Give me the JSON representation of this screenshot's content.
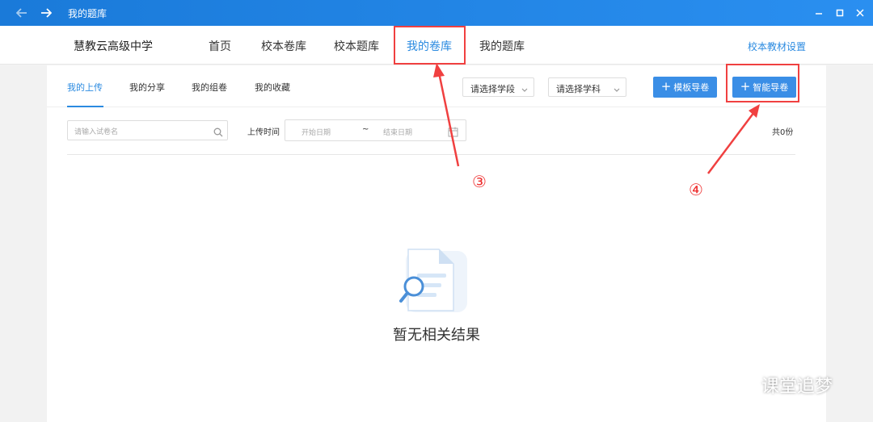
{
  "window": {
    "title": "我的题库"
  },
  "header": {
    "school_name": "慧教云高级中学",
    "nav": [
      "首页",
      "校本卷库",
      "校本题库",
      "我的卷库",
      "我的题库"
    ],
    "active_nav": "我的卷库",
    "textbook_settings": "校本教材设置"
  },
  "subtabs": [
    "我的上传",
    "我的分享",
    "我的组卷",
    "我的收藏"
  ],
  "active_subtab": "我的上传",
  "filters": {
    "stage_select": "请选择学段",
    "subject_select": "请选择学科",
    "template_button": "模板导卷",
    "smart_button": "智能导卷",
    "search_placeholder": "请输入试卷名",
    "upload_time_label": "上传时间",
    "start_date_placeholder": "开始日期",
    "range_separator": "~",
    "end_date_placeholder": "结束日期",
    "total": "共0份"
  },
  "empty_state": {
    "text": "暂无相关结果"
  },
  "annotations": {
    "step3": "③",
    "step4": "④"
  },
  "watermark": {
    "text": "课堂追梦"
  },
  "colors": {
    "accent": "#2a8ae0",
    "titlebar": "#1a7ad9",
    "annotation": "#f04040",
    "button": "#3a8ee6"
  }
}
